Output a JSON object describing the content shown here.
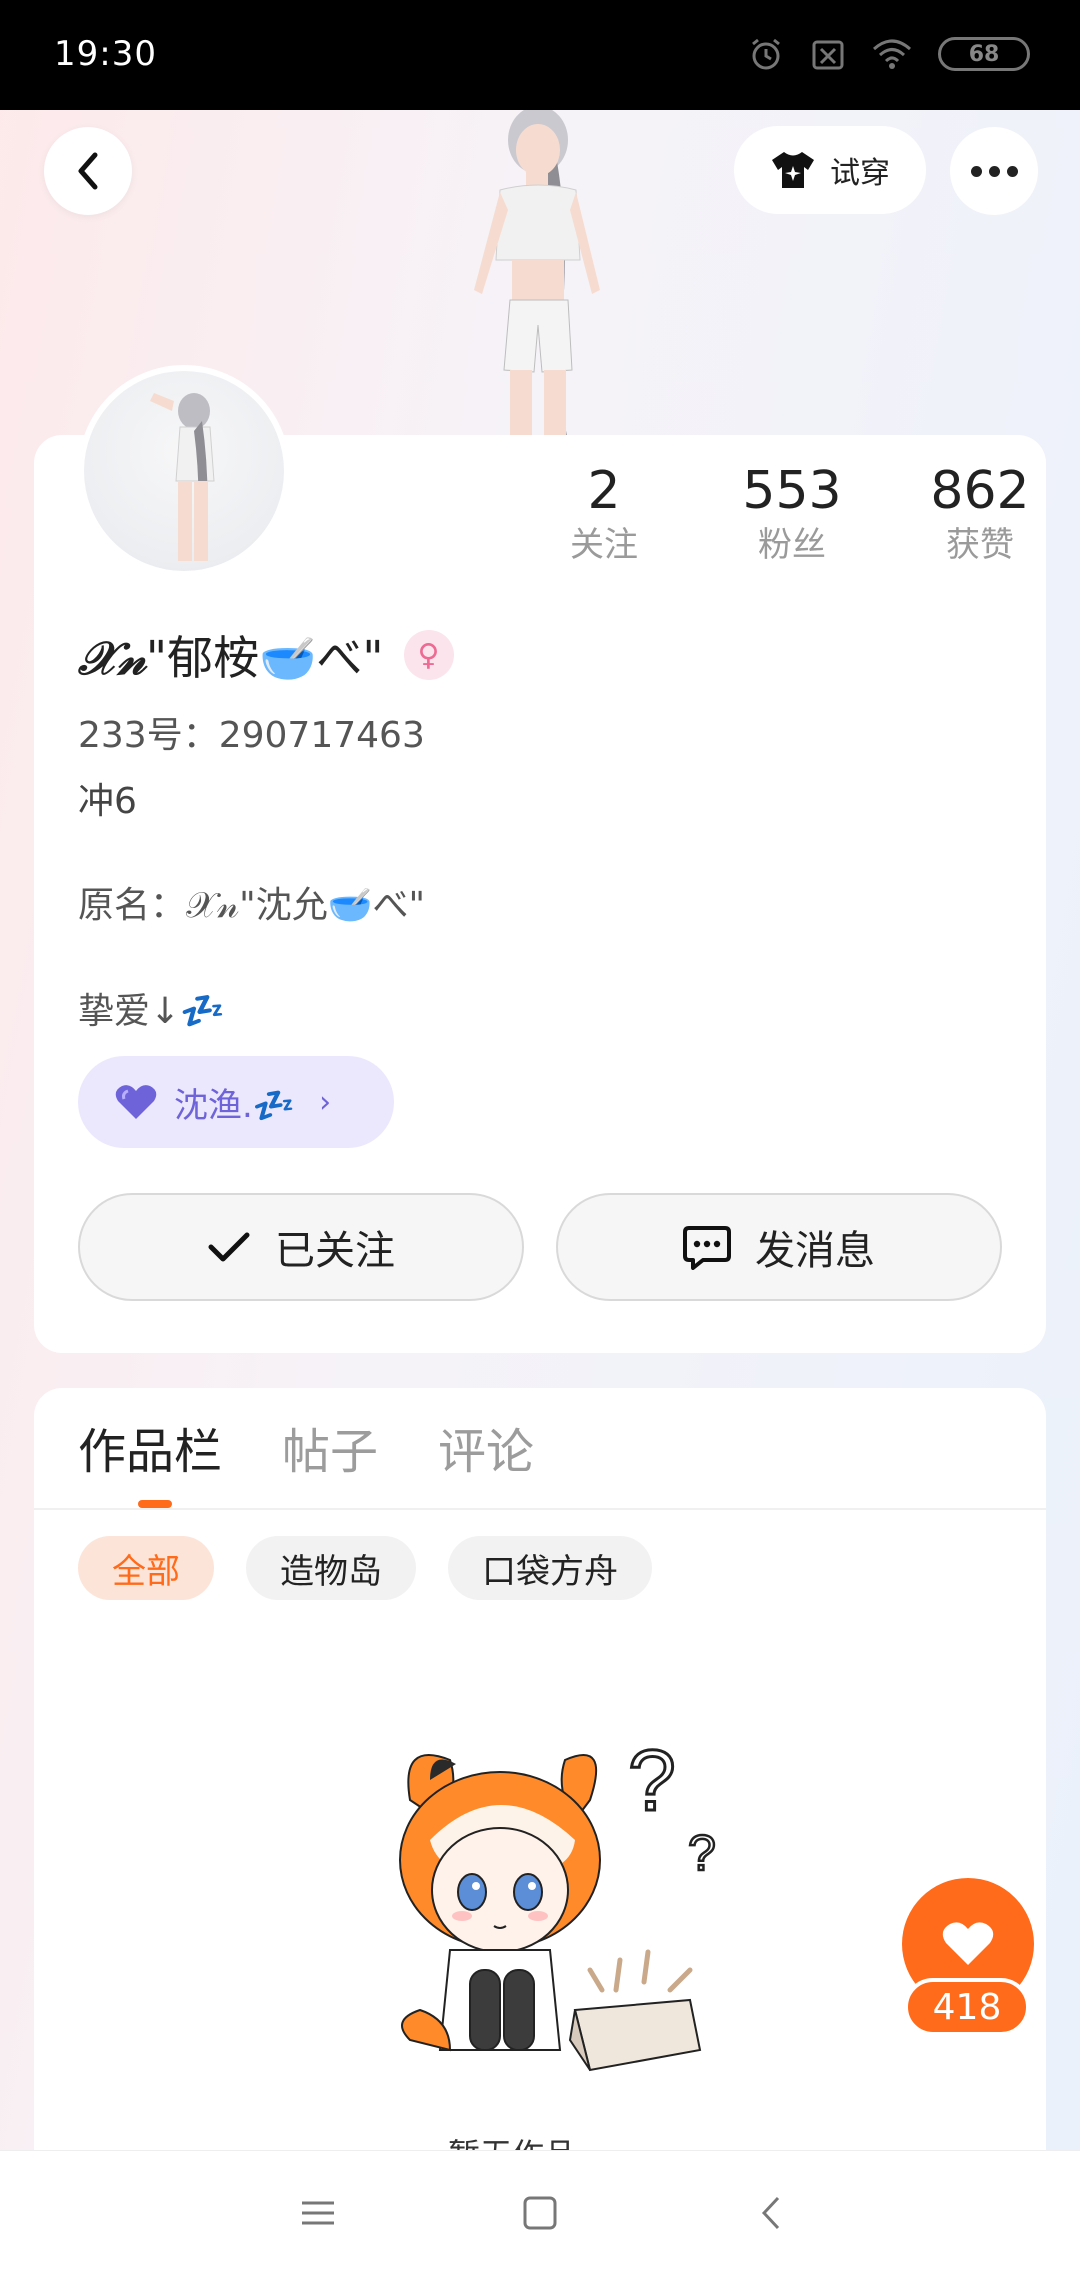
{
  "status_bar": {
    "time": "19:30",
    "battery": "68",
    "icons": [
      "alarm-icon",
      "sim-off-icon",
      "wifi-icon",
      "battery-icon"
    ]
  },
  "header": {
    "back_icon": "chevron-left-icon",
    "tryon_label": "试穿",
    "more_icon": "more-dots-icon"
  },
  "profile": {
    "stats": [
      {
        "value": "2",
        "label": "关注"
      },
      {
        "value": "553",
        "label": "粉丝"
      },
      {
        "value": "862",
        "label": "获赞"
      }
    ],
    "nickname_prefix": "𝒳𝓃",
    "nickname_main": "\"郁桉🥣べ\"",
    "gender_symbol": "♀",
    "uid": "233号：290717463",
    "signature": "冲6",
    "original_name": "原名：𝒳𝓃\"沈允🥣べ\"",
    "love_label": "挚爱↓💤",
    "relation_name": "沈渔.💤",
    "follow_label": "已关注",
    "message_label": "发消息"
  },
  "works": {
    "tabs": [
      "作品栏",
      "帖子",
      "评论"
    ],
    "active_tab": 0,
    "filters": [
      "全部",
      "造物岛",
      "口袋方舟"
    ],
    "active_filter": 0,
    "empty_text": "暂无作品"
  },
  "like": {
    "count": "418"
  },
  "colors": {
    "accent": "#ff6b1a",
    "relation": "#6e63d9"
  }
}
